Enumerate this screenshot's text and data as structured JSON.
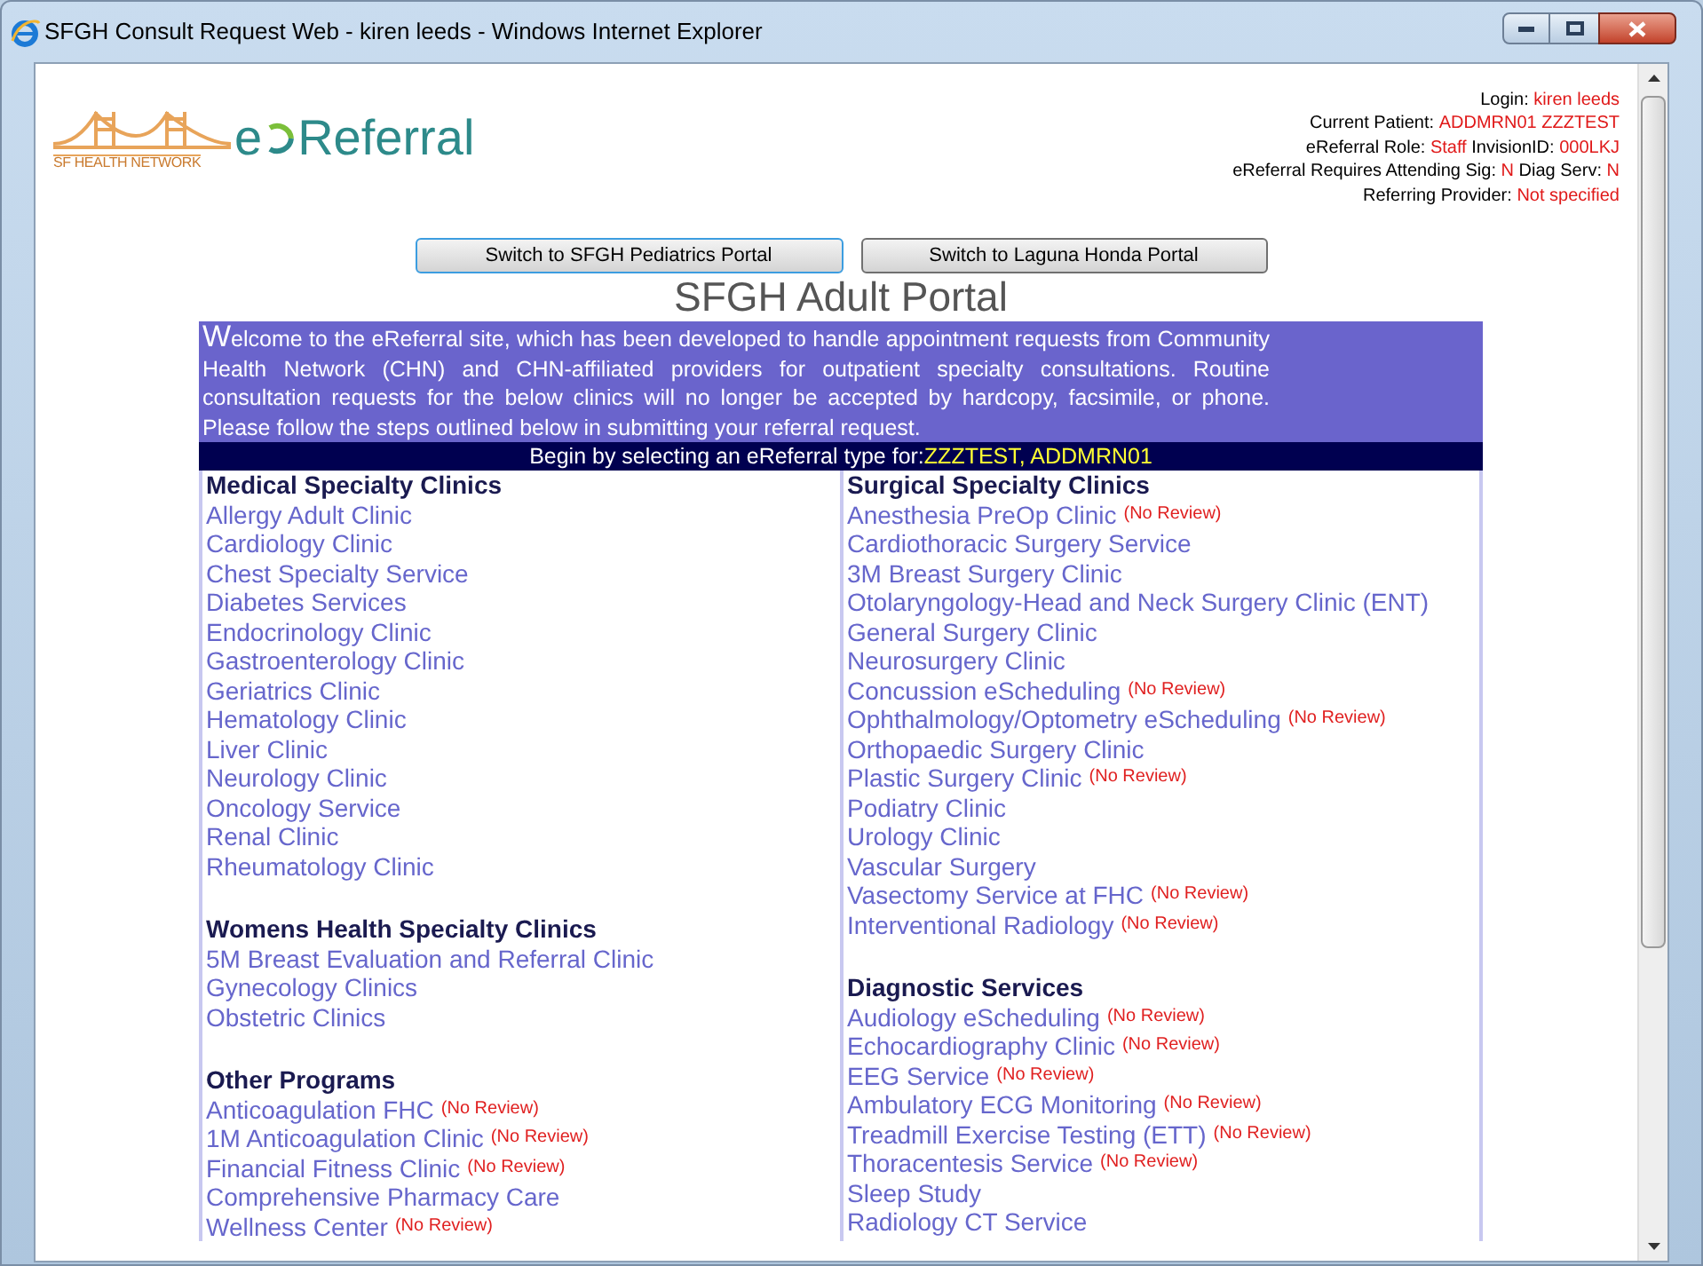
{
  "window": {
    "title": "SFGH Consult Request Web - kiren leeds - Windows Internet Explorer"
  },
  "logo": {
    "network": "SF HEALTH NETWORK",
    "prefix": "e",
    "name": "Referral"
  },
  "user_info": [
    [
      {
        "text": "Login: ",
        "highlight": false
      },
      {
        "text": "kiren leeds",
        "highlight": true
      }
    ],
    [
      {
        "text": "Current Patient: ",
        "highlight": false
      },
      {
        "text": "ADDMRN01 ZZZTEST",
        "highlight": true
      }
    ],
    [
      {
        "text": "eReferral Role: ",
        "highlight": false
      },
      {
        "text": "Staff",
        "highlight": true
      },
      {
        "text": " InvisionID: ",
        "highlight": false
      },
      {
        "text": "000LKJ",
        "highlight": true
      }
    ],
    [
      {
        "text": "eReferral Requires Attending Sig: ",
        "highlight": false
      },
      {
        "text": "N",
        "highlight": true
      },
      {
        "text": " Diag Serv: ",
        "highlight": false
      },
      {
        "text": "N",
        "highlight": true
      }
    ],
    [
      {
        "text": "Referring Provider: ",
        "highlight": false
      },
      {
        "text": "Not specified",
        "highlight": true
      }
    ]
  ],
  "portal_buttons": [
    {
      "label": "Switch to SFGH Pediatrics Portal",
      "focused": true
    },
    {
      "label": "Switch to Laguna Honda Portal",
      "focused": false
    }
  ],
  "portal_title": "SFGH Adult Portal",
  "welcome": "Welcome to the eReferral site, which has been developed to handle appointment requests from Community Health Network (CHN) and CHN-affiliated providers for outpatient specialty consultations. Routine consultation requests for the below clinics will no longer be accepted by hardcopy, facsimile, or phone. Please follow the steps outlined below in submitting your referral request.",
  "instruction": {
    "text": "Begin by selecting an eReferral type for:",
    "patient": "ZZZTEST, ADDMRN01"
  },
  "columns": [
    {
      "sections": [
        {
          "heading": "Medical Specialty Clinics",
          "items": [
            {
              "label": "Allergy Adult Clinic"
            },
            {
              "label": "Cardiology Clinic"
            },
            {
              "label": "Chest Specialty Service"
            },
            {
              "label": "Diabetes Services"
            },
            {
              "label": "Endocrinology Clinic"
            },
            {
              "label": "Gastroenterology Clinic"
            },
            {
              "label": "Geriatrics Clinic"
            },
            {
              "label": "Hematology Clinic"
            },
            {
              "label": "Liver Clinic"
            },
            {
              "label": "Neurology Clinic"
            },
            {
              "label": "Oncology Service"
            },
            {
              "label": "Renal Clinic"
            },
            {
              "label": "Rheumatology Clinic"
            }
          ]
        },
        {
          "heading": "Womens Health Specialty Clinics",
          "items": [
            {
              "label": "5M Breast Evaluation and Referral Clinic"
            },
            {
              "label": "Gynecology Clinics"
            },
            {
              "label": "Obstetric Clinics"
            }
          ]
        },
        {
          "heading": "Other Programs",
          "items": [
            {
              "label": "Anticoagulation FHC",
              "note": "(No Review)"
            },
            {
              "label": "1M Anticoagulation Clinic",
              "note": "(No Review)"
            },
            {
              "label": "Financial Fitness Clinic",
              "note": "(No Review)"
            },
            {
              "label": "Comprehensive Pharmacy Care"
            },
            {
              "label": "Wellness Center",
              "note": "(No Review)"
            }
          ]
        }
      ]
    },
    {
      "sections": [
        {
          "heading": "Surgical Specialty Clinics",
          "items": [
            {
              "label": "Anesthesia PreOp Clinic",
              "note": "(No Review)"
            },
            {
              "label": "Cardiothoracic Surgery Service"
            },
            {
              "label": "3M Breast Surgery Clinic"
            },
            {
              "label": "Otolaryngology-Head and Neck Surgery Clinic (ENT)"
            },
            {
              "label": "General Surgery Clinic"
            },
            {
              "label": "Neurosurgery Clinic"
            },
            {
              "label": "Concussion eScheduling",
              "note": "(No Review)"
            },
            {
              "label": "Ophthalmology/Optometry eScheduling",
              "note": "(No Review)"
            },
            {
              "label": "Orthopaedic Surgery Clinic"
            },
            {
              "label": "Plastic Surgery Clinic",
              "note": "(No Review)"
            },
            {
              "label": "Podiatry Clinic"
            },
            {
              "label": "Urology Clinic"
            },
            {
              "label": "Vascular Surgery"
            },
            {
              "label": "Vasectomy Service at FHC",
              "note": "(No Review)"
            },
            {
              "label": "Interventional Radiology",
              "note": "(No Review)"
            }
          ]
        },
        {
          "heading": "Diagnostic Services",
          "items": [
            {
              "label": "Audiology eScheduling",
              "note": "(No Review)"
            },
            {
              "label": "Echocardiography Clinic",
              "note": "(No Review)"
            },
            {
              "label": "EEG Service",
              "note": "(No Review)"
            },
            {
              "label": "Ambulatory ECG Monitoring",
              "note": "(No Review)"
            },
            {
              "label": "Treadmill Exercise Testing (ETT)",
              "note": "(No Review)"
            },
            {
              "label": "Thoracentesis Service",
              "note": "(No Review)"
            },
            {
              "label": "Sleep Study"
            },
            {
              "label": "Radiology CT Service"
            }
          ]
        }
      ]
    }
  ]
}
